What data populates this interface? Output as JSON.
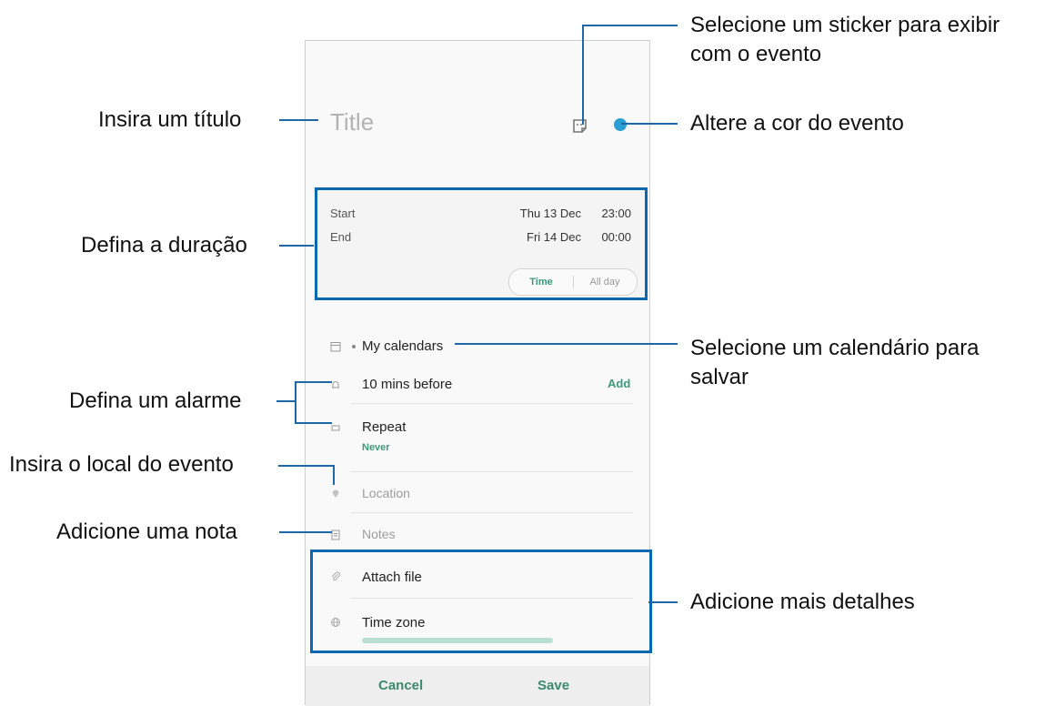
{
  "colors": {
    "accent": "#3b9a78",
    "frame": "#0a68b0",
    "event_color": "#2a9fd3"
  },
  "event_form": {
    "title_placeholder": "Title",
    "duration": {
      "start_label": "Start",
      "start_date": "Thu 13 Dec",
      "start_time": "23:00",
      "end_label": "End",
      "end_date": "Fri 14 Dec",
      "end_time": "00:00",
      "toggle_time": "Time",
      "toggle_allday": "All day"
    },
    "calendar": "My calendars",
    "alarm": {
      "value": "10 mins before",
      "add_label": "Add"
    },
    "repeat": {
      "label": "Repeat",
      "value": "Never"
    },
    "location_placeholder": "Location",
    "notes_placeholder": "Notes",
    "attach_file": "Attach file",
    "time_zone": {
      "label": "Time zone"
    },
    "cancel_label": "Cancel",
    "save_label": "Save"
  },
  "icons": [
    "sticker-icon",
    "calendar-icon",
    "bell-icon",
    "repeat-icon",
    "location-pin-icon",
    "notes-icon",
    "attach-icon",
    "globe-icon"
  ],
  "callouts": {
    "sticker_line1": "Selecione um sticker para exibir",
    "sticker_line2": "com o evento",
    "title": "Insira um título",
    "color": "Altere a cor do evento",
    "duration": "Defina a duração",
    "calendar_line1": "Selecione um calendário para",
    "calendar_line2": "salvar",
    "alarm": "Defina um alarme",
    "location": "Insira o local do evento",
    "note": "Adicione uma nota",
    "more": "Adicione mais detalhes"
  }
}
